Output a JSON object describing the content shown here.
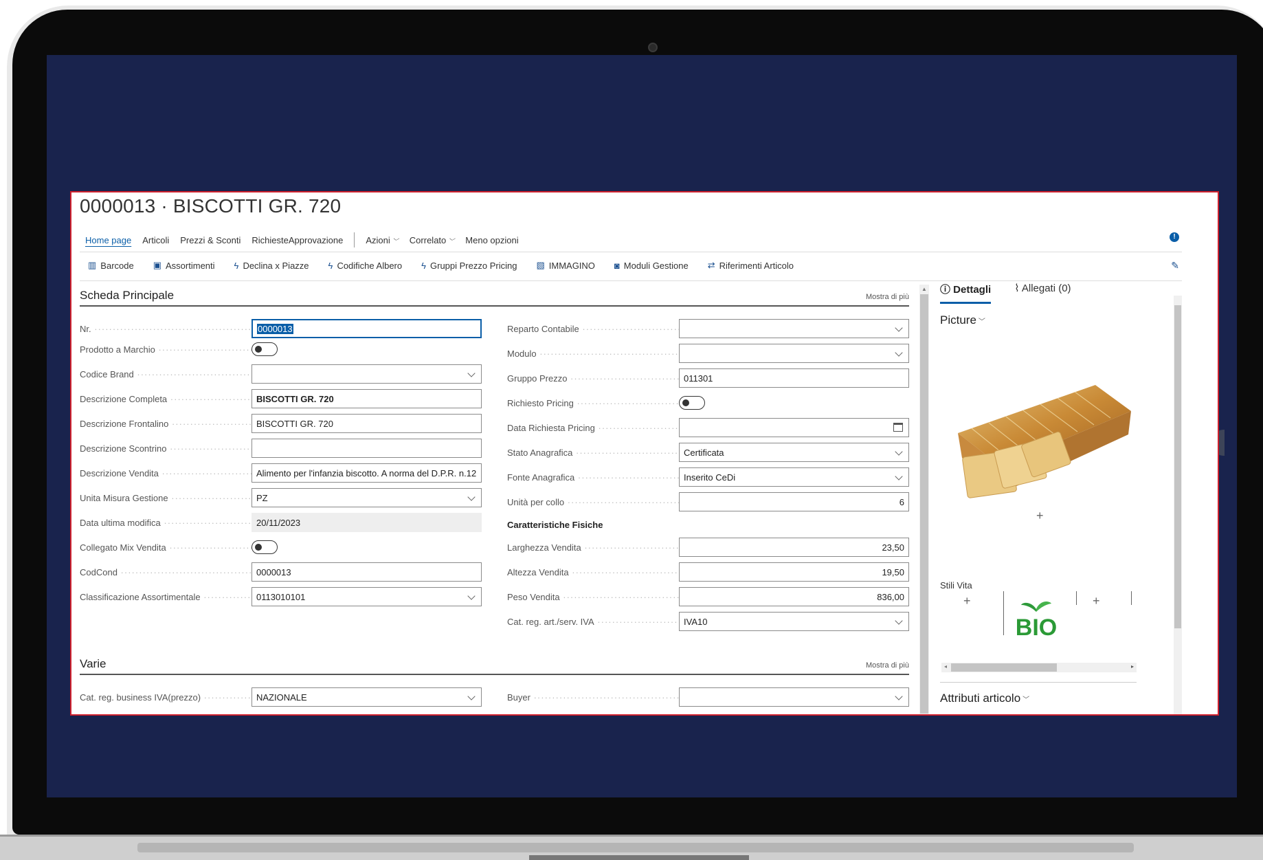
{
  "record": {
    "title": "0000013 · BISCOTTI  GR. 720"
  },
  "nav": {
    "items": [
      "Home page",
      "Articoli",
      "Prezzi & Sconti",
      "RichiesteApprovazione"
    ],
    "menus": [
      "Azioni",
      "Correlato"
    ],
    "less": "Meno opzioni"
  },
  "actions": [
    "Barcode",
    "Assortimenti",
    "Declina x Piazze",
    "Codifiche Albero",
    "Gruppi Prezzo Pricing",
    "IMMAGINO",
    "Moduli Gestione",
    "Riferimenti Articolo"
  ],
  "scheda": {
    "title": "Scheda Principale",
    "more": "Mostra di più",
    "left": {
      "nr": {
        "label": "Nr.",
        "value": "0000013"
      },
      "marchio": {
        "label": "Prodotto a Marchio"
      },
      "brand": {
        "label": "Codice Brand",
        "value": ""
      },
      "desc_completa": {
        "label": "Descrizione Completa",
        "value": "BISCOTTI GR. 720"
      },
      "desc_frontalino": {
        "label": "Descrizione Frontalino",
        "value": "BISCOTTI GR. 720"
      },
      "desc_scontrino": {
        "label": "Descrizione Scontrino",
        "value": ""
      },
      "desc_vendita": {
        "label": "Descrizione Vendita",
        "value": "Alimento per l'infanzia biscotto. A norma del D.P.R. n.12"
      },
      "unita": {
        "label": "Unita Misura Gestione",
        "value": "PZ"
      },
      "data_mod": {
        "label": "Data ultima modifica",
        "value": "20/11/2023"
      },
      "mix": {
        "label": "Collegato Mix Vendita"
      },
      "codcond": {
        "label": "CodCond",
        "value": "0000013"
      },
      "class": {
        "label": "Classificazione Assortimentale",
        "value": "0113010101"
      }
    },
    "right": {
      "reparto": {
        "label": "Reparto Contabile",
        "value": ""
      },
      "modulo": {
        "label": "Modulo",
        "value": ""
      },
      "gruppo": {
        "label": "Gruppo Prezzo",
        "value": "011301"
      },
      "rich_pricing": {
        "label": "Richiesto Pricing"
      },
      "data_rich": {
        "label": "Data Richiesta Pricing",
        "value": ""
      },
      "stato": {
        "label": "Stato Anagrafica",
        "value": "Certificata"
      },
      "fonte": {
        "label": "Fonte Anagrafica",
        "value": "Inserito CeDi"
      },
      "collo": {
        "label": "Unità per collo",
        "value": "6"
      },
      "caratteristiche": "Caratteristiche Fisiche",
      "larghezza": {
        "label": "Larghezza Vendita",
        "value": "23,50"
      },
      "altezza": {
        "label": "Altezza Vendita",
        "value": "19,50"
      },
      "peso": {
        "label": "Peso Vendita",
        "value": "836,00"
      },
      "iva": {
        "label": "Cat. reg. art./serv. IVA",
        "value": "IVA10"
      }
    }
  },
  "varie": {
    "title": "Varie",
    "more": "Mostra di più",
    "business": {
      "label": "Cat. reg. business IVA(prezzo)",
      "value": "NAZIONALE"
    },
    "buyer": {
      "label": "Buyer",
      "value": ""
    }
  },
  "side": {
    "tab_details": "Dettagli",
    "tab_attach": "Allegati (0)",
    "picture": "Picture",
    "stili": "Stili Vita",
    "bio_text": "BIO",
    "attributi": "Attributi articolo"
  },
  "colors": {
    "accent": "#0a5ea8",
    "frame": "#d0202d",
    "screen": "#19234d"
  },
  "icons": {
    "actions": [
      "barcode-icon",
      "assortment-icon",
      "lightning-icon",
      "lightning-icon",
      "lightning-icon",
      "image-icon",
      "modules-icon",
      "swap-icon"
    ]
  }
}
